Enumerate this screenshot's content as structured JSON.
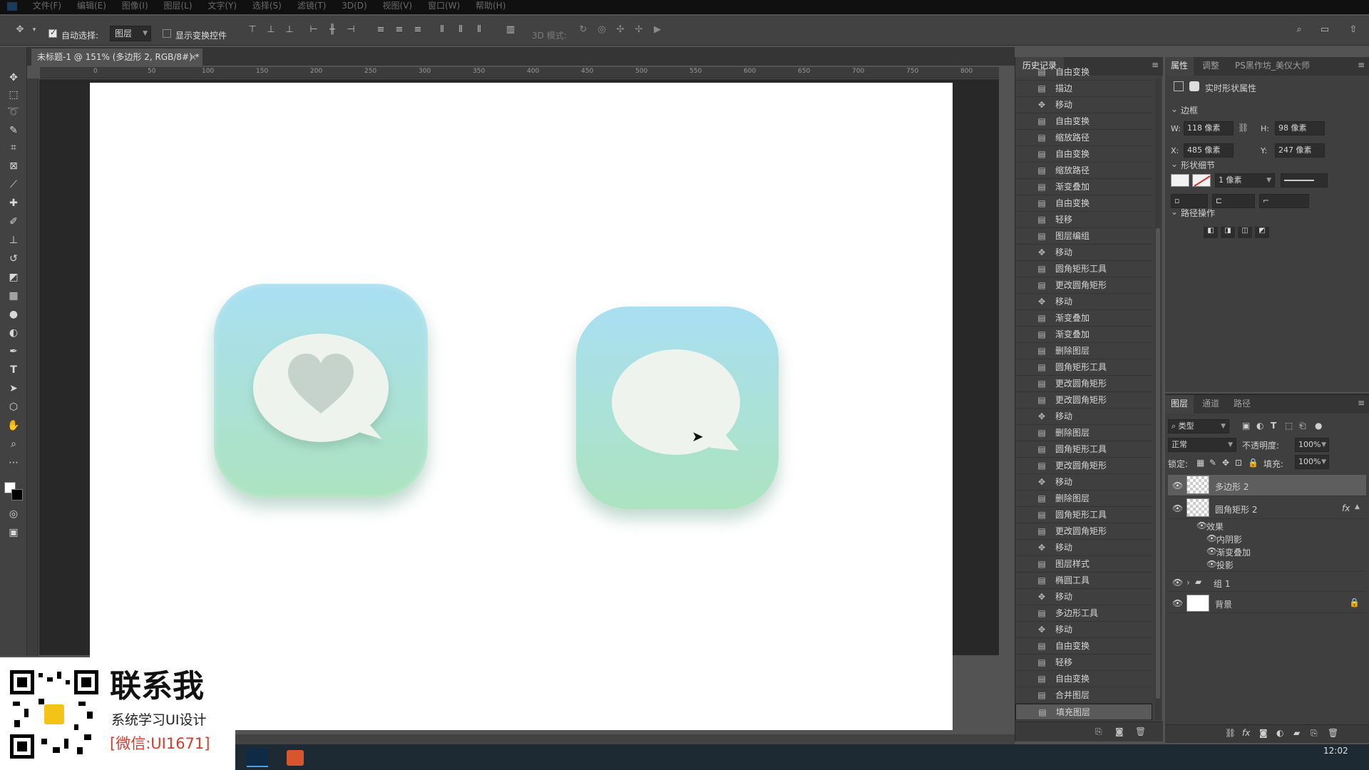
{
  "menu": {
    "items": [
      "文件(F)",
      "编辑(E)",
      "图像(I)",
      "图层(L)",
      "文字(Y)",
      "选择(S)",
      "滤镜(T)",
      "3D(D)",
      "视图(V)",
      "窗口(W)",
      "帮助(H)"
    ]
  },
  "options": {
    "auto_select_label": "自动选择:",
    "auto_select_value": "图层",
    "show_transform_label": "显示变换控件",
    "mode_3d_label": "3D 模式:"
  },
  "document": {
    "tab_title": "未标题-1 @ 151% (多边形 2, RGB/8#) *",
    "tab_close": "×"
  },
  "ruler": {
    "h_labels": [
      "0",
      "50",
      "100",
      "150",
      "200",
      "250",
      "300",
      "350",
      "400",
      "450",
      "500",
      "550",
      "600",
      "650",
      "700",
      "750",
      "800"
    ]
  },
  "history": {
    "title": "历史记录",
    "items": [
      {
        "icon": "doc",
        "label": "自由变换"
      },
      {
        "icon": "doc",
        "label": "描边"
      },
      {
        "icon": "move",
        "label": "移动"
      },
      {
        "icon": "doc",
        "label": "自由变换"
      },
      {
        "icon": "doc",
        "label": "缩放路径"
      },
      {
        "icon": "doc",
        "label": "自由变换"
      },
      {
        "icon": "doc",
        "label": "缩放路径"
      },
      {
        "icon": "doc",
        "label": "渐变叠加"
      },
      {
        "icon": "doc",
        "label": "自由变换"
      },
      {
        "icon": "doc",
        "label": "轻移"
      },
      {
        "icon": "doc",
        "label": "图层编组"
      },
      {
        "icon": "move",
        "label": "移动"
      },
      {
        "icon": "doc",
        "label": "圆角矩形工具"
      },
      {
        "icon": "doc",
        "label": "更改圆角矩形"
      },
      {
        "icon": "move",
        "label": "移动"
      },
      {
        "icon": "doc",
        "label": "渐变叠加"
      },
      {
        "icon": "doc",
        "label": "渐变叠加"
      },
      {
        "icon": "doc",
        "label": "删除图层"
      },
      {
        "icon": "doc",
        "label": "圆角矩形工具"
      },
      {
        "icon": "doc",
        "label": "更改圆角矩形"
      },
      {
        "icon": "doc",
        "label": "更改圆角矩形"
      },
      {
        "icon": "move",
        "label": "移动"
      },
      {
        "icon": "doc",
        "label": "删除图层"
      },
      {
        "icon": "doc",
        "label": "圆角矩形工具"
      },
      {
        "icon": "doc",
        "label": "更改圆角矩形"
      },
      {
        "icon": "move",
        "label": "移动"
      },
      {
        "icon": "doc",
        "label": "删除图层"
      },
      {
        "icon": "doc",
        "label": "圆角矩形工具"
      },
      {
        "icon": "doc",
        "label": "更改圆角矩形"
      },
      {
        "icon": "move",
        "label": "移动"
      },
      {
        "icon": "doc",
        "label": "图层样式"
      },
      {
        "icon": "doc",
        "label": "椭圆工具"
      },
      {
        "icon": "move",
        "label": "移动"
      },
      {
        "icon": "doc",
        "label": "多边形工具"
      },
      {
        "icon": "move",
        "label": "移动"
      },
      {
        "icon": "doc",
        "label": "自由变换"
      },
      {
        "icon": "doc",
        "label": "轻移"
      },
      {
        "icon": "doc",
        "label": "自由变换"
      },
      {
        "icon": "doc",
        "label": "合并图层"
      },
      {
        "icon": "doc",
        "label": "填充图层"
      }
    ]
  },
  "properties": {
    "tabs": [
      "属性",
      "调整",
      "PS黑作坊_美仪大师"
    ],
    "header": "实时形状属性",
    "section_bounds": "边框",
    "w_label": "W:",
    "w_value": "118 像素",
    "h_label": "H:",
    "h_value": "98 像素",
    "x_label": "X:",
    "x_value": "485 像素",
    "y_label": "Y:",
    "y_value": "247 像素",
    "section_shape": "形状细节",
    "stroke_width": "1 像素",
    "section_path": "路径操作"
  },
  "layers": {
    "tabs": [
      "图层",
      "通道",
      "路径"
    ],
    "filter_label": "类型",
    "blend_mode": "正常",
    "opacity_label": "不透明度:",
    "opacity_value": "100%",
    "lock_label": "锁定:",
    "fill_label": "填充:",
    "fill_value": "100%",
    "items": {
      "polygon": "多边形 2",
      "rect": "圆角矩形 2",
      "effects": "效果",
      "inner_shadow": "内阴影",
      "gradient_overlay": "渐变叠加",
      "drop_shadow": "投影",
      "group": "组 1",
      "background": "背景"
    },
    "fx": "fx"
  },
  "taskbar": {
    "time": "12:02"
  },
  "watermark": {
    "line1": "联系我",
    "line2": "系统学习UI设计",
    "line3": "[微信:UI1671]"
  },
  "colors": {
    "tile_top": "#a9dff2",
    "tile_bottom": "#ace3bf",
    "bubble": "#eef3ee",
    "accent_red": "#d93a2b"
  }
}
